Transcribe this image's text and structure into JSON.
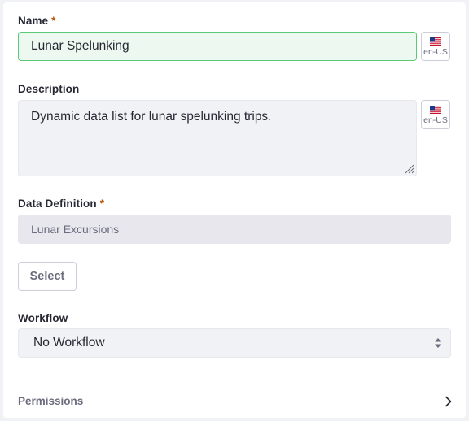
{
  "fields": {
    "name": {
      "label": "Name",
      "required_mark": "*",
      "value": "Lunar Spelunking",
      "lang": "en-US"
    },
    "description": {
      "label": "Description",
      "value": "Dynamic data list for lunar spelunking trips.",
      "lang": "en-US"
    },
    "data_definition": {
      "label": "Data Definition",
      "required_mark": "*",
      "value": "Lunar Excursions",
      "select_label": "Select"
    },
    "workflow": {
      "label": "Workflow",
      "selected": "No Workflow"
    }
  },
  "permissions": {
    "label": "Permissions"
  },
  "icons": {
    "flag": "us-flag-icon",
    "resize": "resize-grip-icon",
    "select_arrows": "sort-arrows-icon",
    "expand": "chevron-right-icon"
  },
  "colors": {
    "required": "#b95000",
    "valid_border": "#5aca75",
    "valid_bg": "#edf9f0",
    "text": "#272833",
    "muted": "#6b6c7e"
  }
}
